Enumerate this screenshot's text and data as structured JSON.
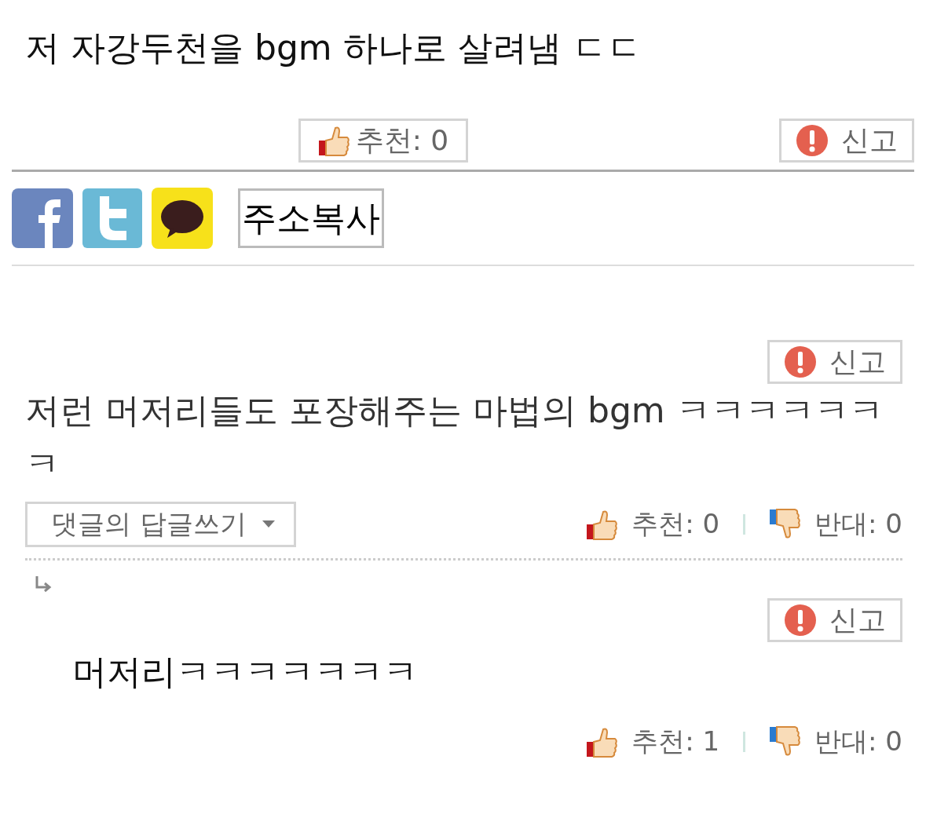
{
  "post": {
    "text": "저 자강두천을 bgm 하나로 살려냄 ㄷㄷ",
    "recommend": "추천: 0",
    "report": "신고"
  },
  "share": {
    "copy_button": "주소복사"
  },
  "comments": [
    {
      "report": "신고",
      "text": "저런 머저리들도 포장해주는 마법의 bgm ㅋㅋㅋㅋㅋㅋㅋ",
      "reply_button": "댓글의 답글쓰기",
      "recommend": "추천: 0",
      "oppose": "반대: 0",
      "children": [
        {
          "report": "신고",
          "text": "머저리ㅋㅋㅋㅋㅋㅋㅋ",
          "recommend": "추천: 1",
          "oppose": "반대: 0"
        }
      ]
    }
  ]
}
